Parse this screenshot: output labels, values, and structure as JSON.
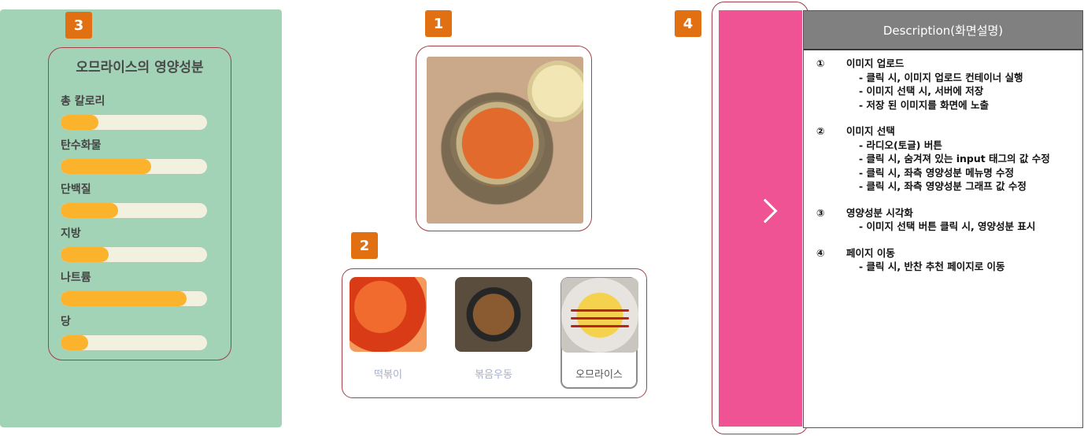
{
  "markers": {
    "m1": "1",
    "m2": "2",
    "m3": "3",
    "m4": "4"
  },
  "nutrition": {
    "title": "오므라이스의 영양성분",
    "items": [
      {
        "label": "총 칼로리",
        "level": 0.26
      },
      {
        "label": "탄수화물",
        "level": 0.62
      },
      {
        "label": "단백질",
        "level": 0.39
      },
      {
        "label": "지방",
        "level": 0.33
      },
      {
        "label": "나트륨",
        "level": 0.86
      },
      {
        "label": "당",
        "level": 0.19
      }
    ],
    "bar_color": "#fbb22d",
    "track_color": "#f2f0de",
    "panel_color": "#a2d3b7"
  },
  "main_image": {
    "icon": "tteokbokki-photo"
  },
  "food_options": [
    {
      "label": "떡볶이",
      "selected": false,
      "icon": "tteokbokki-thumb"
    },
    {
      "label": "볶음우동",
      "selected": false,
      "icon": "stir-fried-udon-thumb"
    },
    {
      "label": "오므라이스",
      "selected": true,
      "icon": "omurice-thumb"
    }
  ],
  "next_panel": {
    "color": "#ef5394",
    "icon": "chevron-right-icon"
  },
  "description": {
    "header": "Description(화면설명)",
    "sections": [
      {
        "num": "①",
        "title": "이미지 업로드",
        "lines": [
          "- 클릭 시, 이미지 업로드 컨테이너 실행",
          "- 이미지 선택 시, 서버에 저장",
          "- 저장 된 이미지를 화면에 노출"
        ]
      },
      {
        "num": "②",
        "title": "이미지 선택",
        "lines": [
          "- 라디오(토글) 버튼",
          "- 클릭 시, 숨겨져 있는 input 태그의 값 수정",
          "- 클릭 시, 좌측 영양성분 메뉴명 수정",
          "- 클릭 시, 좌측 영양성분 그래프 값 수정"
        ]
      },
      {
        "num": "③",
        "title": "영양성분 시각화",
        "lines": [
          "- 이미지 선택 버튼 클릭 시, 영양성분 표시"
        ]
      },
      {
        "num": "④",
        "title": "페이지 이동",
        "lines": [
          "- 클릭 시, 반찬 추천 페이지로 이동"
        ]
      }
    ]
  }
}
